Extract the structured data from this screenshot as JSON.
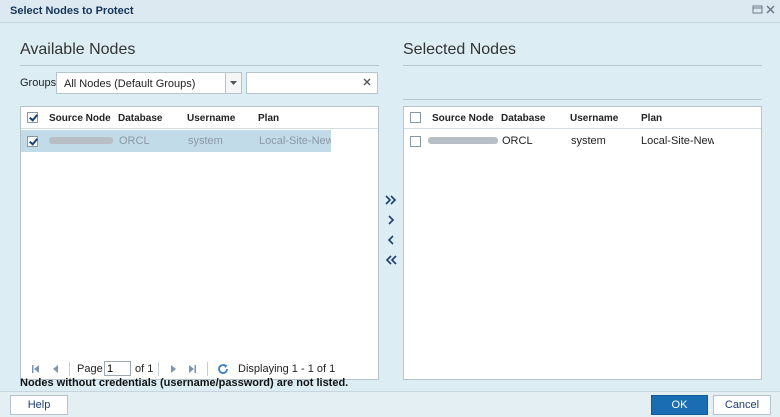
{
  "dialog": {
    "title": "Select Nodes to Protect"
  },
  "available": {
    "title": "Available Nodes",
    "groups_label": "Groups",
    "groups_selected": "All Nodes (Default Groups)",
    "columns": [
      "Source Node",
      "Database",
      "Username",
      "Plan"
    ],
    "rows": [
      {
        "source_node": "",
        "database": "ORCL",
        "username": "system",
        "plan": "Local-Site-New-P",
        "checked": true
      }
    ],
    "pager": {
      "page_label": "Page",
      "page_value": "1",
      "of_label": "of 1",
      "display_text": "Displaying 1 - 1 of 1"
    }
  },
  "selected": {
    "title": "Selected Nodes",
    "columns": [
      "Source Node",
      "Database",
      "Username",
      "Plan"
    ],
    "rows": [
      {
        "source_node": "",
        "database": "ORCL",
        "username": "system",
        "plan": "Local-Site-New-P",
        "checked": false
      }
    ]
  },
  "move_buttons": [
    "move-all-right-icon",
    "move-right-icon",
    "move-left-icon",
    "move-all-left-icon"
  ],
  "note": "Nodes without credentials (username/password) are not listed.",
  "buttons": {
    "help": "Help",
    "ok": "OK",
    "cancel": "Cancel"
  },
  "colors": {
    "accent": "#1a6cb3",
    "selection": "#c2dbe9",
    "title_text": "#15365a"
  }
}
